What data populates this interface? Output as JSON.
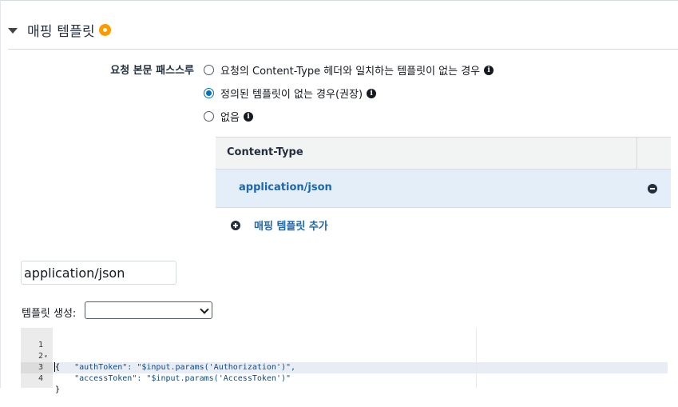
{
  "section": {
    "title": "매핑 템플릿"
  },
  "passthrough": {
    "label": "요청 본문 패스스루",
    "options": [
      {
        "label": "요청의 Content-Type 헤더와 일치하는 템플릿이 없는 경우",
        "selected": false
      },
      {
        "label": "정의된 템플릿이 없는 경우(권장)",
        "selected": true
      },
      {
        "label": "없음",
        "selected": false
      }
    ]
  },
  "content_type_table": {
    "header": "Content-Type",
    "rows": [
      {
        "value": "application/json",
        "selected": true
      }
    ],
    "add_label": "매핑 템플릿 추가"
  },
  "editor_panel": {
    "content_type_input_value": "application/json",
    "generate_label": "템플릿 생성:",
    "generate_selected": ""
  },
  "code_editor": {
    "line_numbers": [
      "1",
      "2",
      "3",
      "4"
    ],
    "lines": [
      "{",
      "    \"authToken\": \"$input.params('Authorization')\",",
      "    \"accessToken\": \"$input.params('AccessToken')\"",
      "}"
    ]
  },
  "colors": {
    "accent": "#0073bb",
    "link": "#1b66b1",
    "status": "#ff9900",
    "selected_row": "#e3eef9"
  }
}
